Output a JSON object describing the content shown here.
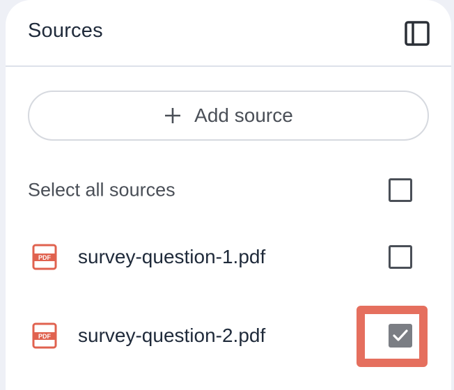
{
  "header": {
    "title": "Sources",
    "toggle_icon": "side-panel-icon"
  },
  "add_source": {
    "label": "Add source",
    "icon": "plus-icon"
  },
  "select_all": {
    "label": "Select all sources",
    "checked": false
  },
  "sources": [
    {
      "name": "survey-question-1.pdf",
      "icon": "pdf-icon",
      "checked": false
    },
    {
      "name": "survey-question-2.pdf",
      "icon": "pdf-icon",
      "checked": true
    }
  ],
  "colors": {
    "pdf_red": "#e0624f",
    "checked_fill": "#7b7e84",
    "highlight": "#e56f5e",
    "text": "#1f2a3a"
  }
}
